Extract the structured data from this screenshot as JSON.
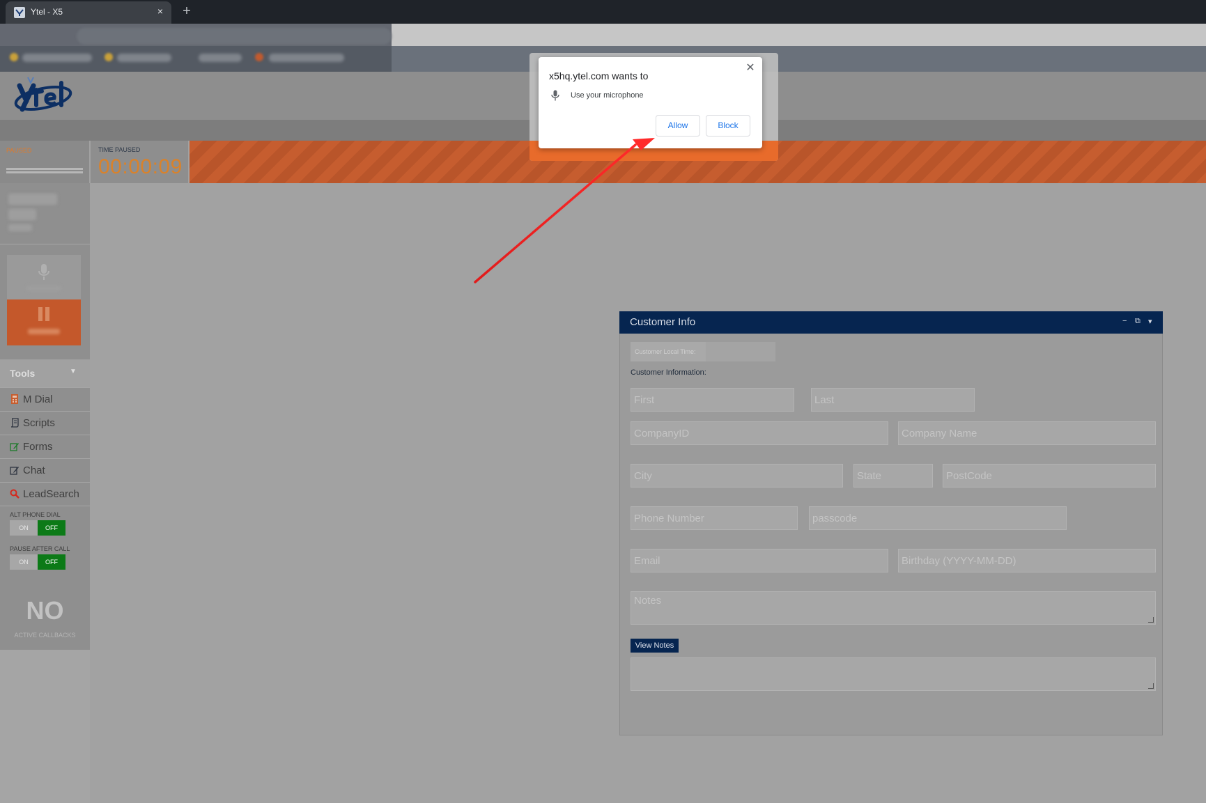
{
  "browser": {
    "tab_title": "Ytel - X5",
    "tab_close": "×",
    "new_tab": "+"
  },
  "status": {
    "paused_label": "PAUSED",
    "time_label": "TIME PAUSED",
    "time_value": "00:00:09"
  },
  "sidebar": {
    "tools_label": "Tools",
    "tools_caret": "▼",
    "items": [
      {
        "label": "M Dial",
        "icon": "calculator-icon"
      },
      {
        "label": "Scripts",
        "icon": "scroll-icon"
      },
      {
        "label": "Forms",
        "icon": "form-edit-icon"
      },
      {
        "label": "Chat",
        "icon": "chat-edit-icon"
      },
      {
        "label": "LeadSearch",
        "icon": "search-icon"
      }
    ],
    "alt_phone_dial": {
      "label": "ALT PHONE DIAL",
      "on": "ON",
      "off": "OFF"
    },
    "pause_after_call": {
      "label": "PAUSE AFTER CALL",
      "on": "ON",
      "off": "OFF"
    },
    "callbacks_count": "NO",
    "callbacks_label": "ACTIVE CALLBACKS"
  },
  "customer_info": {
    "title": "Customer Info",
    "controls": [
      "−",
      "⧉",
      "▾"
    ],
    "local_time_label": "Customer Local Time:",
    "info_label": "Customer Information:",
    "placeholders": {
      "first": "First",
      "last": "Last",
      "company_id": "CompanyID",
      "company_name": "Company Name",
      "city": "City",
      "state": "State",
      "postcode": "PostCode",
      "phone": "Phone Number",
      "passcode": "passcode",
      "email": "Email",
      "birthday": "Birthday (YYYY-MM-DD)",
      "notes": "Notes"
    },
    "view_notes_label": "View Notes"
  },
  "dialog": {
    "title": "x5hq.ytel.com wants to",
    "permission": "Use your microphone",
    "allow_label": "Allow",
    "block_label": "Block",
    "close": "✕"
  },
  "colors": {
    "accent_orange": "#e86b2b",
    "navy": "#062550",
    "toggle_green": "#0c7a17",
    "link_blue": "#1a73e8"
  }
}
